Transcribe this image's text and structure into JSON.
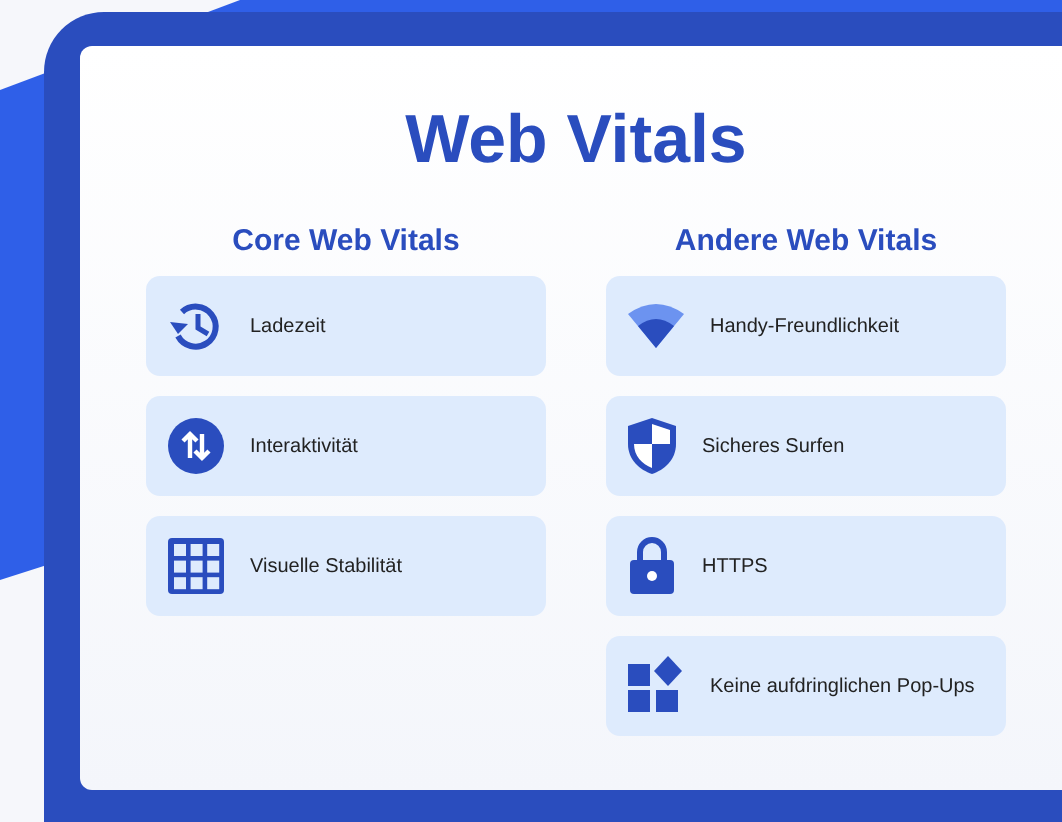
{
  "title": "Web Vitals",
  "columns": [
    {
      "heading": "Core Web Vitals",
      "items": [
        {
          "label": "Ladezeit"
        },
        {
          "label": "Interaktivität"
        },
        {
          "label": "Visuelle Stabilität"
        }
      ]
    },
    {
      "heading": "Andere Web Vitals",
      "items": [
        {
          "label": "Handy-Freundlichkeit"
        },
        {
          "label": "Sicheres Surfen"
        },
        {
          "label": "HTTPS"
        },
        {
          "label": "Keine aufdringlichen Pop-Ups"
        }
      ]
    }
  ]
}
